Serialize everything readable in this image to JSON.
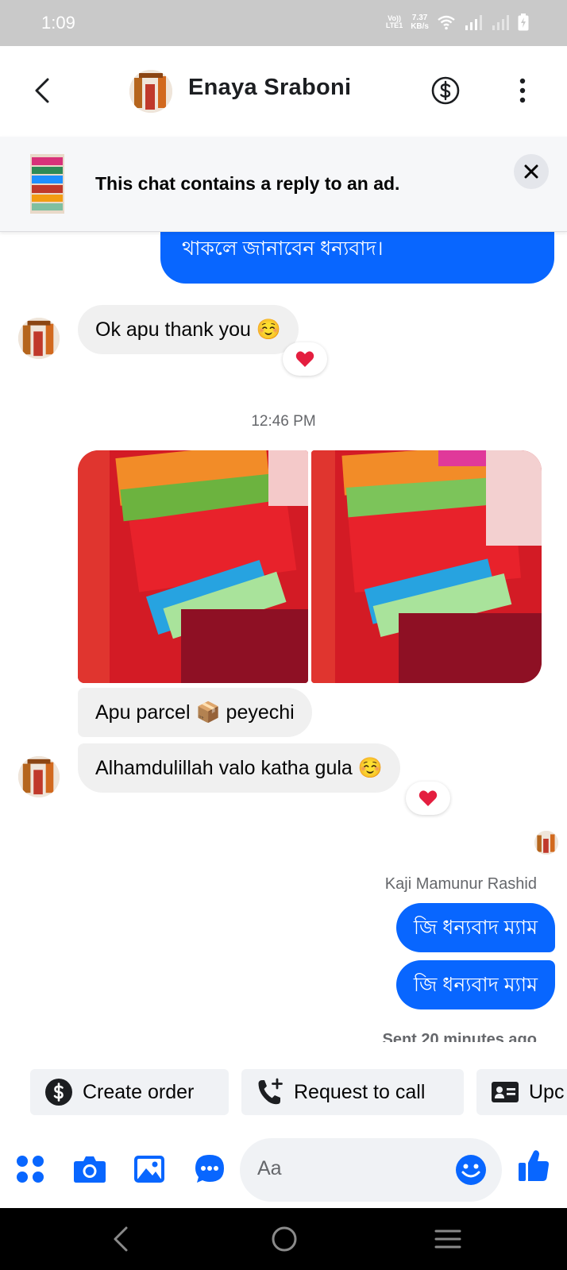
{
  "status_bar": {
    "time": "1:09",
    "network_label_top": "Vo))",
    "network_label_bottom": "LTE1",
    "speed_value": "7.37",
    "speed_unit": "KB/s"
  },
  "header": {
    "contact_name": "Enaya Sraboni",
    "icons": [
      "back-arrow-icon",
      "dollar-icon",
      "more-vertical-icon"
    ]
  },
  "ad_banner": {
    "text": "This chat contains a reply to an ad."
  },
  "messages": {
    "top_outgoing": "থাকলে জানাবেন ধন্যবাদ।",
    "incoming_1": "Ok apu thank you ☺️",
    "reaction_1": "❤️",
    "timestamp": "12:46 PM",
    "incoming_2": "Apu parcel 📦 peyechi",
    "incoming_3": "Alhamdulillah valo katha gula ☺️",
    "reaction_2": "❤️",
    "sender_name": "Kaji Mamunur Rashid",
    "outgoing_1": "জি ধন্যবাদ ম্যাম",
    "outgoing_2": "জি ধন্যবাদ ম্যাম",
    "sent_status": "Sent 20 minutes ago"
  },
  "quick_actions": [
    {
      "label": "Create order",
      "icon": "dollar-circle-icon"
    },
    {
      "label": "Request to call",
      "icon": "phone-plus-icon"
    },
    {
      "label": "Upc",
      "icon": "contact-card-icon"
    }
  ],
  "composer": {
    "placeholder": "Aa"
  },
  "colors": {
    "accent": "#0866ff",
    "incoming_bubble": "#f0f0f0",
    "reaction_heart": "#e41e3f"
  }
}
